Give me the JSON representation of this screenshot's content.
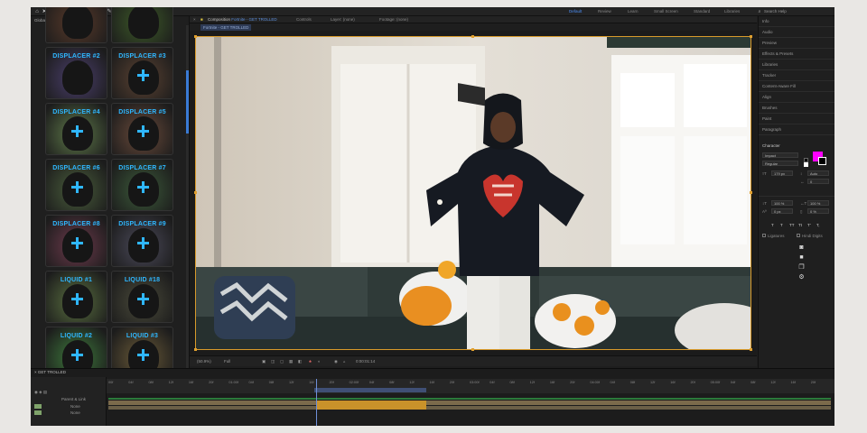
{
  "toolbar": {
    "snapping_label": "Snapping",
    "workspaces": [
      "Default",
      "Review",
      "Learn",
      "Small Screen",
      "Standard",
      "Libraries"
    ],
    "search_label": "Search Help"
  },
  "left_panel": {
    "title": "GlobalFx (dev) Extension",
    "tiles": [
      {
        "label": "",
        "plus": false,
        "bg": "#5a3a2a"
      },
      {
        "label": "",
        "plus": false,
        "bg": "#3d5a28"
      },
      {
        "label": "DISPLACER #2",
        "plus": false,
        "bg": "#4b3f6d"
      },
      {
        "label": "DISPLACER #3",
        "plus": true,
        "bg": "#5b4232"
      },
      {
        "label": "DISPLACER #4",
        "plus": true,
        "bg": "#5f7a4a"
      },
      {
        "label": "DISPLACER #5",
        "plus": true,
        "bg": "#6a4a3a"
      },
      {
        "label": "DISPLACER #6",
        "plus": true,
        "bg": "#4a5e3c"
      },
      {
        "label": "DISPLACER #7",
        "plus": true,
        "bg": "#3c5a3a"
      },
      {
        "label": "DISPLACER #8",
        "plus": true,
        "bg": "#6d3a4c"
      },
      {
        "label": "DISPLACER #9",
        "plus": true,
        "bg": "#4b4a5a"
      },
      {
        "label": "LIQUID #1",
        "plus": true,
        "bg": "#5a7040"
      },
      {
        "label": "LIQUID #18",
        "plus": true,
        "bg": "#4a4a3a"
      },
      {
        "label": "LIQUID #2",
        "plus": true,
        "bg": "#3e7a3c"
      },
      {
        "label": "LIQUID #3",
        "plus": true,
        "bg": "#6a5a38"
      }
    ]
  },
  "composition": {
    "tab_prefix": "Composition",
    "comp_name": "Fortnite - GET TROLLED",
    "other_tabs": [
      "Controls",
      "Layer: (none)",
      "Footage: (none)"
    ],
    "breadcrumb": "Fortnite - GET TROLLED",
    "zoom": "(50.9%)",
    "quality": "Full",
    "timecode": "0:00:01:14"
  },
  "right_panel": {
    "items": [
      "Info",
      "Audio",
      "Preview",
      "Effects & Presets",
      "Libraries",
      "Tracker",
      "Content-Aware Fill",
      "Align",
      "Brushes",
      "Paint",
      "Paragraph"
    ],
    "character": {
      "title": "Character",
      "font": "Impact",
      "style": "Regular",
      "size": "179 px",
      "leading": "Auto",
      "tracking": "0",
      "vscale": "100 %",
      "hscale": "100 %",
      "baseline": "0 px",
      "tsume": "0 %",
      "text_styles": [
        "T",
        "T",
        "TT",
        "Tt",
        "T'",
        "T,"
      ],
      "ligatures": "Ligatures",
      "hindi": "Hindi Digits",
      "fill_color": "#ff00ff"
    }
  },
  "timeline": {
    "tab": "GET TROLLED",
    "layers": [
      "Parent & Link",
      "None",
      "None"
    ],
    "ticks": [
      "00f",
      "04f",
      "08f",
      "12f",
      "16f",
      "20f",
      "01:00f",
      "04f",
      "08f",
      "12f",
      "16f",
      "20f",
      "02:00f",
      "04f",
      "08f",
      "12f",
      "16f",
      "20f",
      "03:00f",
      "04f",
      "08f",
      "12f",
      "16f",
      "20f",
      "04:00f",
      "04f",
      "08f",
      "12f",
      "16f",
      "20f",
      "05:00f",
      "04f",
      "08f",
      "12f",
      "16f",
      "20f"
    ]
  }
}
